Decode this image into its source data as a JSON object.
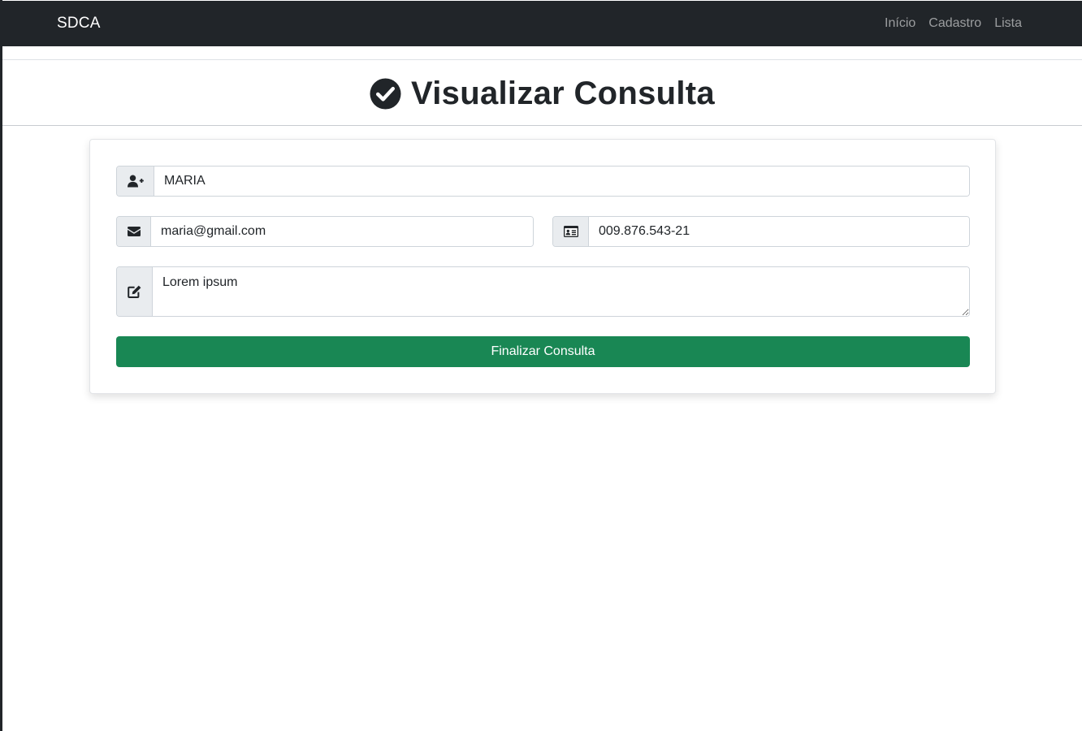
{
  "navbar": {
    "brand": "SDCA",
    "links": [
      "Início",
      "Cadastro",
      "Lista"
    ]
  },
  "header": {
    "title": "Visualizar Consulta",
    "icon": "check-circle-icon"
  },
  "form": {
    "name": {
      "icon": "user-plus-icon",
      "value": "MARIA"
    },
    "email": {
      "icon": "envelope-icon",
      "value": "maria@gmail.com"
    },
    "cpf": {
      "icon": "id-card-icon",
      "value": "009.876.543-21"
    },
    "notes": {
      "icon": "edit-icon",
      "value": "Lorem ipsum"
    },
    "submit_label": "Finalizar Consulta"
  },
  "colors": {
    "navbar": "#212529",
    "submit_button": "#198754",
    "addon_bg": "#e9ecef"
  }
}
